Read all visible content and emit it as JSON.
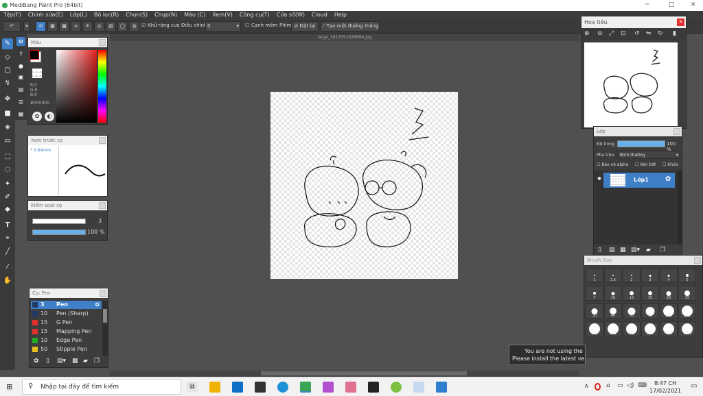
{
  "window": {
    "title": "MediBang Paint Pro (64bit)"
  },
  "menu": [
    "Tệp(F)",
    "Chỉnh sửa(E)",
    "Lớp(L)",
    "Bộ lọc(R)",
    "Chọn(S)",
    "Chụp(N)",
    "Màu (C)",
    "Xem(V)",
    "Công cụ(T)",
    "Cửa sổ(W)",
    "Cloud",
    "Help"
  ],
  "toolbar": {
    "antialias_label": "Khử răng cưa",
    "adjust_label": "Điều chỉnh",
    "adjust_value": "0",
    "edge_label": "Cạnh mềm",
    "key_label": "Phím",
    "reset_label": "Đặt lại",
    "straight_line_label": "Tạo một đường thẳng"
  },
  "document": {
    "tab_name": "large_1613551028694.jpg"
  },
  "color_panel": {
    "title": "Màu",
    "r": "R:0",
    "g": "G:0",
    "b": "B:0",
    "hex": "#000000",
    "fg": "#000000",
    "bg": "#ffffff"
  },
  "preview_panel": {
    "title": "Xem trước cọ",
    "size": "0.64mm"
  },
  "control_panel": {
    "title": "Kiểm soát cọ",
    "size_value": "3",
    "opacity_value": "100 %"
  },
  "brush_panel": {
    "title": "Cọ: Pen",
    "items": [
      {
        "size": "3",
        "name": "Pen",
        "color": "#1f3b66",
        "selected": true
      },
      {
        "size": "10",
        "name": "Pen (Sharp)",
        "color": "#1f3b66"
      },
      {
        "size": "15",
        "name": "G Pen",
        "color": "#e03030"
      },
      {
        "size": "15",
        "name": "Mapping Pen",
        "color": "#e03030"
      },
      {
        "size": "10",
        "name": "Edge Pen",
        "color": "#22aa22"
      },
      {
        "size": "50",
        "name": "Stipple Pen",
        "color": "#e8c020"
      }
    ]
  },
  "navigator": {
    "title": "Hoa tiêu"
  },
  "layer_panel": {
    "title": "Lớp",
    "opacity_label": "Độ trong",
    "opacity_value": "100 %",
    "blend_label": "Pha trộn",
    "blend_value": "Bình thường",
    "protect_alpha": "Bảo vệ alpha",
    "clipping": "Xén bớt",
    "lock": "Khóa",
    "layers": [
      {
        "name": "Lớp1"
      }
    ]
  },
  "brush_size_panel": {
    "title": "Brush Size",
    "sizes": [
      "1",
      "1.5",
      "2",
      "3",
      "4",
      "5",
      "7",
      "10",
      "12",
      "15",
      "20",
      "25",
      "30",
      "40",
      "50",
      "70",
      "100",
      "150",
      "200",
      "300",
      "400",
      "500",
      "700",
      "1000"
    ]
  },
  "notification": {
    "line1": "You are not using the la",
    "line2": "Please install the latest ve"
  },
  "taskbar": {
    "search_placeholder": "Nhập tại đây để tìm kiếm",
    "time": "8:47 CH",
    "date": "17/02/2021"
  }
}
